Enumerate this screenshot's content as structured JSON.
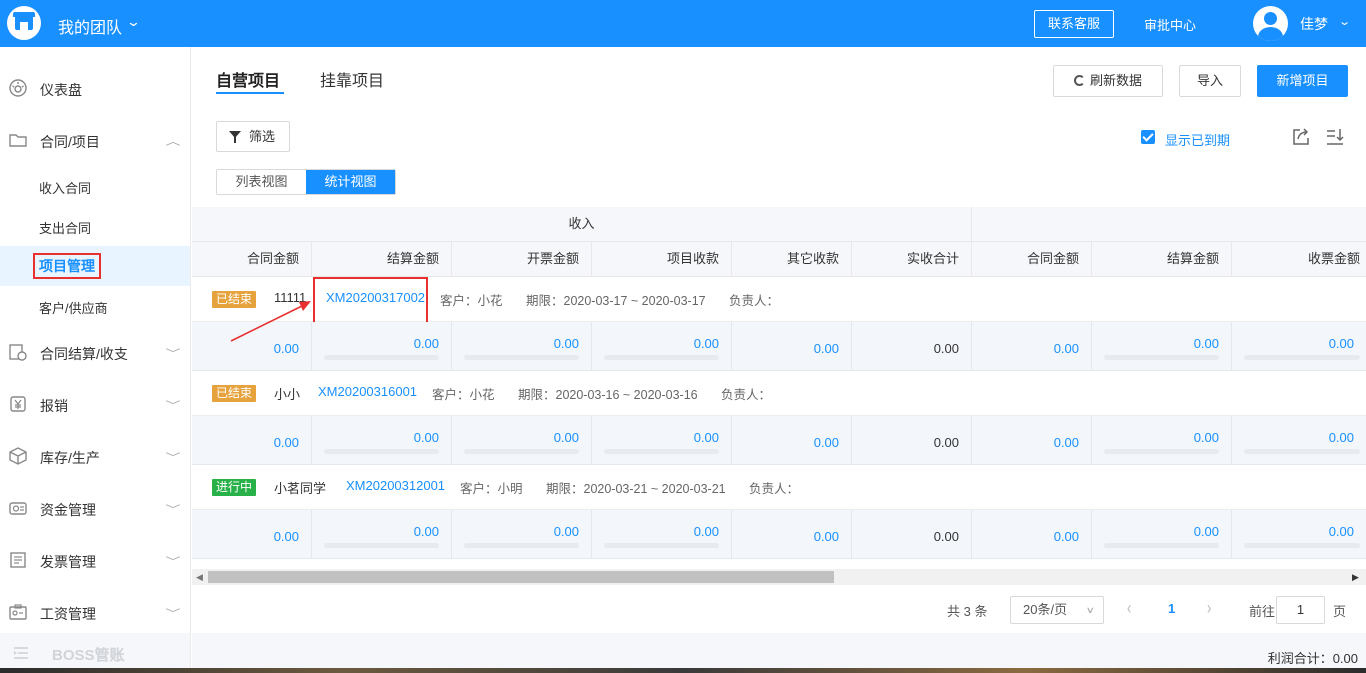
{
  "header": {
    "team_name": "我的团队",
    "contact_label": "联系客服",
    "approval_label": "审批中心",
    "username": "佳梦"
  },
  "sidebar": {
    "items": [
      {
        "label": "仪表盘",
        "icon": "dashboard-icon"
      },
      {
        "label": "合同/项目",
        "icon": "folder-icon",
        "expanded": true
      },
      {
        "label": "合同结算/收支",
        "icon": "settlement-icon"
      },
      {
        "label": "报销",
        "icon": "reimburse-icon"
      },
      {
        "label": "库存/生产",
        "icon": "box-icon"
      },
      {
        "label": "资金管理",
        "icon": "money-icon"
      },
      {
        "label": "发票管理",
        "icon": "invoice-icon"
      },
      {
        "label": "工资管理",
        "icon": "salary-icon"
      }
    ],
    "sub_items": [
      "收入合同",
      "支出合同",
      "项目管理",
      "客户/供应商"
    ],
    "active_sub": "项目管理",
    "boss_label": "BOSS管账"
  },
  "main": {
    "tabs": [
      "自营项目",
      "挂靠项目"
    ],
    "active_tab": "自营项目",
    "buttons": {
      "refresh": "刷新数据",
      "import": "导入",
      "add": "新增项目",
      "filter": "筛选"
    },
    "show_expired_label": "显示已到期",
    "show_expired_checked": true,
    "views": [
      "列表视图",
      "统计视图"
    ],
    "active_view": "统计视图"
  },
  "table": {
    "group_header": "收入",
    "columns": [
      "合同金额",
      "结算金额",
      "开票金额",
      "项目收款",
      "其它收款",
      "实收合计",
      "合同金额",
      "结算金额",
      "收票金额"
    ],
    "rows": [
      {
        "status": "已结束",
        "status_color": "#e6a23c",
        "name": "11111",
        "code": "XM20200317002",
        "customer": "客户：小花",
        "period": "期限：2020-03-17 ~ 2020-03-17",
        "owner": "负责人：",
        "values": [
          "0.00",
          "0.00",
          "0.00",
          "0.00",
          "0.00",
          "0.00",
          "0.00",
          "0.00",
          "0.00"
        ]
      },
      {
        "status": "已结束",
        "status_color": "#e6a23c",
        "name": "小小",
        "code": "XM20200316001",
        "customer": "客户：小花",
        "period": "期限：2020-03-16 ~ 2020-03-16",
        "owner": "负责人：",
        "values": [
          "0.00",
          "0.00",
          "0.00",
          "0.00",
          "0.00",
          "0.00",
          "0.00",
          "0.00",
          "0.00"
        ]
      },
      {
        "status": "进行中",
        "status_color": "#27b148",
        "name": "小茗同学",
        "code": "XM20200312001",
        "customer": "客户：小明",
        "period": "期限：2020-03-21 ~ 2020-03-21",
        "owner": "负责人：",
        "values": [
          "0.00",
          "0.00",
          "0.00",
          "0.00",
          "0.00",
          "0.00",
          "0.00",
          "0.00",
          "0.00"
        ]
      }
    ]
  },
  "pagination": {
    "total": "共 3 条",
    "page_size": "20条/页",
    "current_page": "1",
    "goto_label": "前往",
    "goto_value": "1",
    "unit": "页"
  },
  "footer": {
    "profit": "利润合计：0.00"
  },
  "colors": {
    "primary": "#1890ff",
    "highlight": "#e83030"
  }
}
